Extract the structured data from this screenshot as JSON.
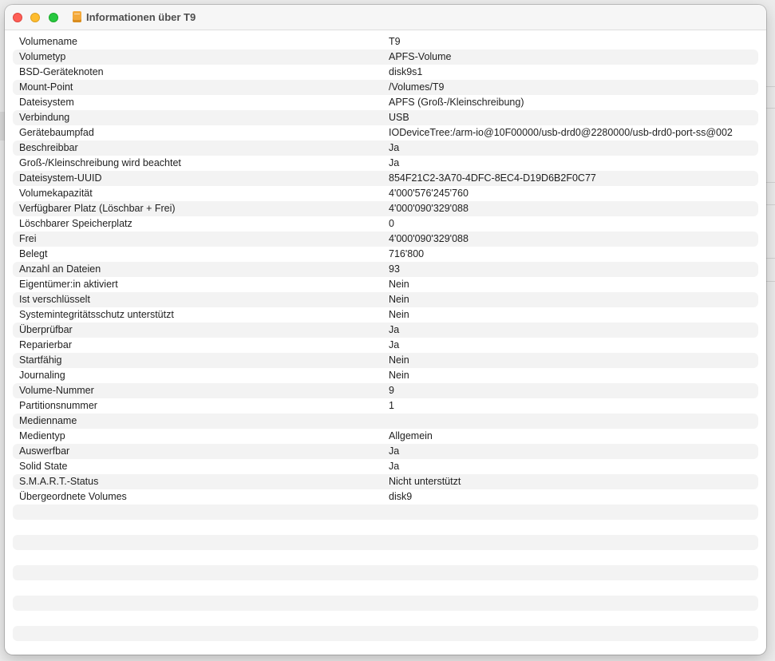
{
  "window": {
    "title": "Informationen über T9",
    "icon": "external-drive-icon"
  },
  "info_rows": [
    {
      "label": "Volumename",
      "value": "T9"
    },
    {
      "label": "Volumetyp",
      "value": "APFS-Volume"
    },
    {
      "label": "BSD-Geräteknoten",
      "value": "disk9s1"
    },
    {
      "label": "Mount-Point",
      "value": "/Volumes/T9"
    },
    {
      "label": "Dateisystem",
      "value": "APFS (Groß-/Kleinschreibung)"
    },
    {
      "label": "Verbindung",
      "value": "USB"
    },
    {
      "label": "Gerätebaumpfad",
      "value": "IODeviceTree:/arm-io@10F00000/usb-drd0@2280000/usb-drd0-port-ss@002"
    },
    {
      "label": "Beschreibbar",
      "value": "Ja"
    },
    {
      "label": "Groß-/Kleinschreibung wird beachtet",
      "value": "Ja"
    },
    {
      "label": "Dateisystem-UUID",
      "value": "854F21C2-3A70-4DFC-8EC4-D19D6B2F0C77"
    },
    {
      "label": "Volumekapazität",
      "value": "4'000'576'245'760"
    },
    {
      "label": "Verfügbarer Platz (Löschbar + Frei)",
      "value": "4'000'090'329'088"
    },
    {
      "label": "Löschbarer Speicherplatz",
      "value": "0"
    },
    {
      "label": "Frei",
      "value": "4'000'090'329'088"
    },
    {
      "label": "Belegt",
      "value": "716'800"
    },
    {
      "label": "Anzahl an Dateien",
      "value": "93"
    },
    {
      "label": "Eigentümer:in aktiviert",
      "value": "Nein"
    },
    {
      "label": "Ist verschlüsselt",
      "value": "Nein"
    },
    {
      "label": "Systemintegritätsschutz unterstützt",
      "value": "Nein"
    },
    {
      "label": "Überprüfbar",
      "value": "Ja"
    },
    {
      "label": "Reparierbar",
      "value": "Ja"
    },
    {
      "label": "Startfähig",
      "value": "Nein"
    },
    {
      "label": "Journaling",
      "value": "Nein"
    },
    {
      "label": "Volume-Nummer",
      "value": "9"
    },
    {
      "label": "Partitionsnummer",
      "value": "1"
    },
    {
      "label": "Medienname",
      "value": ""
    },
    {
      "label": "Medientyp",
      "value": "Allgemein"
    },
    {
      "label": "Auswerfbar",
      "value": "Ja"
    },
    {
      "label": "Solid State",
      "value": "Ja"
    },
    {
      "label": "S.M.A.R.T.-Status",
      "value": "Nicht unterstützt"
    },
    {
      "label": "Übergeordnete Volumes",
      "value": "disk9"
    }
  ],
  "colors": {
    "close": "#fe5f57",
    "minimize": "#febc2e",
    "zoom": "#28c840",
    "row_stripe": "#f3f3f3"
  }
}
